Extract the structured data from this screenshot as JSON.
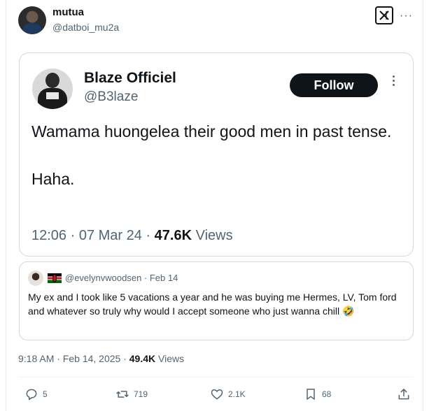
{
  "post": {
    "author_name": "mutua",
    "author_handle": "@datboi_mu2a",
    "timestamp": "9:18 AM · Feb 14, 2025 · ",
    "views_count": "49.4K",
    "views_label": " Views"
  },
  "embedded_tweet": {
    "author_name": "Blaze Officiel",
    "author_handle": "@B3laze",
    "follow_label": "Follow",
    "text": "Wamama huongelea their good men in past tense.\n\nHaha.",
    "time": "12:06 · 07 Mar 24 · ",
    "views_count": "47.6K",
    "views_label": " Views"
  },
  "quoted_reply": {
    "meta": "@evelynvwoodsen · Feb 14",
    "text": "My ex and I took like 5 vacations a year and he was buying me Hermes, LV, Tom ford and whatever so truly why would I accept someone who just wanna chill 🤣"
  },
  "actions": {
    "replies": "5",
    "reposts": "719",
    "likes": "2.1K",
    "bookmarks": "68"
  },
  "icons": [
    "x-logo-icon",
    "more-icon",
    "reply-icon",
    "repost-icon",
    "like-icon",
    "bookmark-icon",
    "share-icon"
  ]
}
